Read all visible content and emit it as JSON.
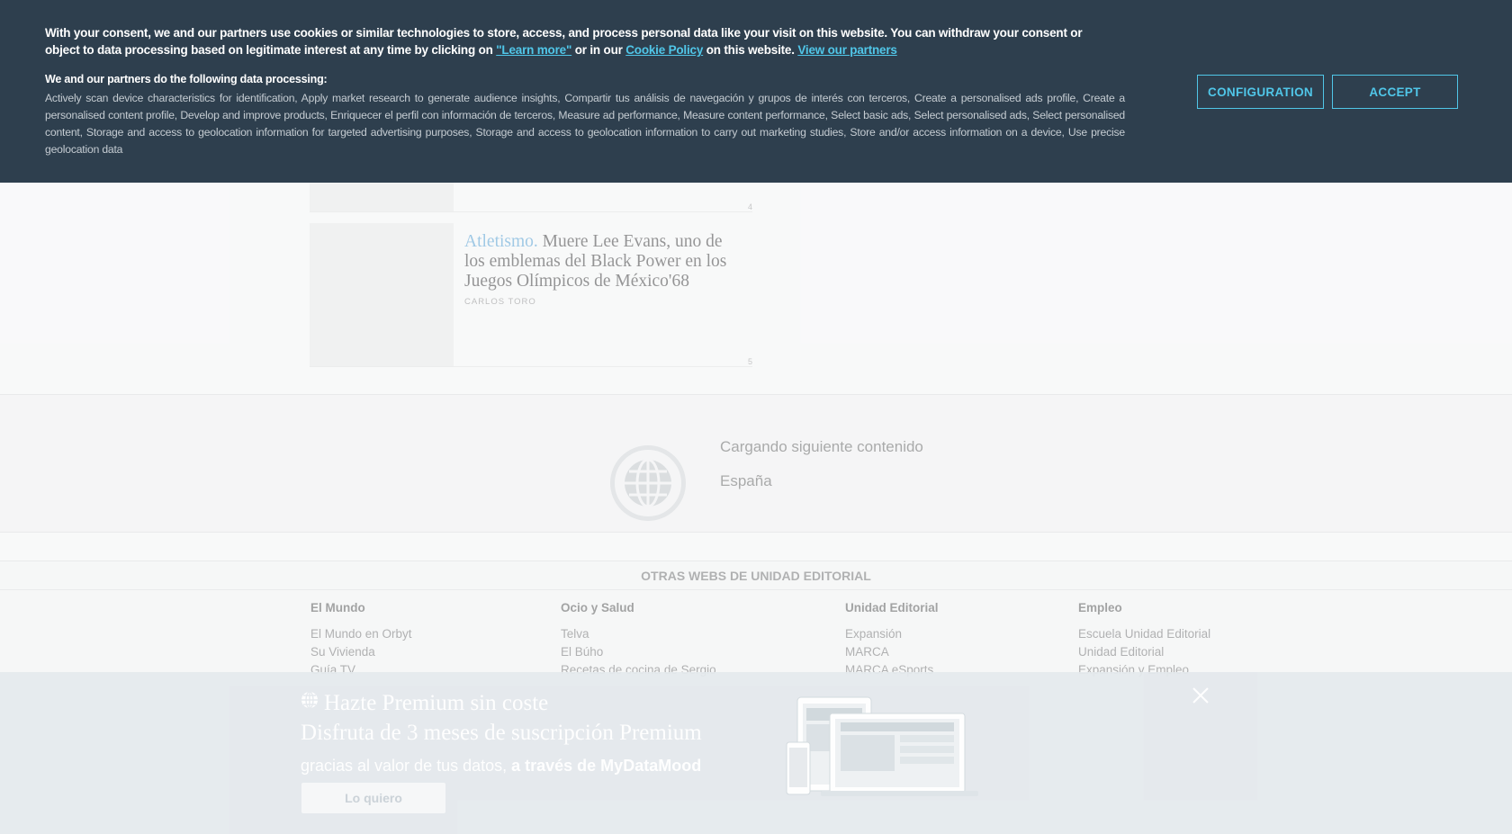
{
  "consent": {
    "intro_1": "With your consent, we and our partners use cookies or similar technologies to store, access, and process personal data like your visit on this website. You can withdraw your consent or object to data processing based on legitimate interest at any time by clicking on ",
    "learn_more": "\"Learn more\"",
    "intro_2": " or in our ",
    "cookie_policy": "Cookie Policy",
    "intro_3": " on this website. ",
    "view_partners": "View our partners",
    "processing_title": "We and our partners do the following data processing:",
    "purposes": "Actively scan device characteristics for identification, Apply market research to generate audience insights, Compartir tus análisis de navegación y grupos de interés con terceros, Create a personalised ads profile, Create a personalised content profile, Develop and improve products, Enriquecer el perfil con información de terceros, Measure ad performance, Measure content performance, Select basic ads, Select personalised ads, Select personalised content, Storage and access to geolocation information for targeted advertising purposes, Storage and access to geolocation information to carry out marketing studies, Store and/or access information on a device, Use precise geolocation data",
    "configuration_label": "CONFIGURATION",
    "accept_label": "ACCEPT",
    "accent_color": "#50c6e8",
    "background_color": "#2e3f4e"
  },
  "stories": [
    {
      "number": "4"
    },
    {
      "kicker": "Atletismo.",
      "headline": "Muere Lee Evans, uno de los emblemas del Black Power en los Juegos Olímpicos de México'68",
      "author": "CARLOS TORO",
      "number": "5"
    }
  ],
  "loading": {
    "text": "Cargando siguiente contenido",
    "section": "España"
  },
  "footer": {
    "title": "OTRAS WEBS DE UNIDAD EDITORIAL",
    "columns": [
      {
        "heading": "El Mundo",
        "links": [
          "El Mundo en Orbyt",
          "Su Vivienda",
          "Guía TV"
        ]
      },
      {
        "heading": "Ocio y Salud",
        "links": [
          "Telva",
          "El Búho",
          "Recetas de cocina de Sergio"
        ]
      },
      {
        "heading": "Unidad Editorial",
        "links": [
          "Expansión",
          "MARCA",
          "MARCA eSports"
        ]
      },
      {
        "heading": "Empleo",
        "links": [
          "Escuela Unidad Editorial",
          "Unidad Editorial",
          "Expansión y Empleo"
        ]
      }
    ]
  },
  "promo": {
    "title": "Hazte Premium sin coste",
    "subtitle": "Disfruta de 3 meses de suscripción Premium",
    "body_plain": "gracias al valor de tus datos, ",
    "body_bold": "a través de MyDataMood",
    "button_label": "Lo quiero"
  }
}
